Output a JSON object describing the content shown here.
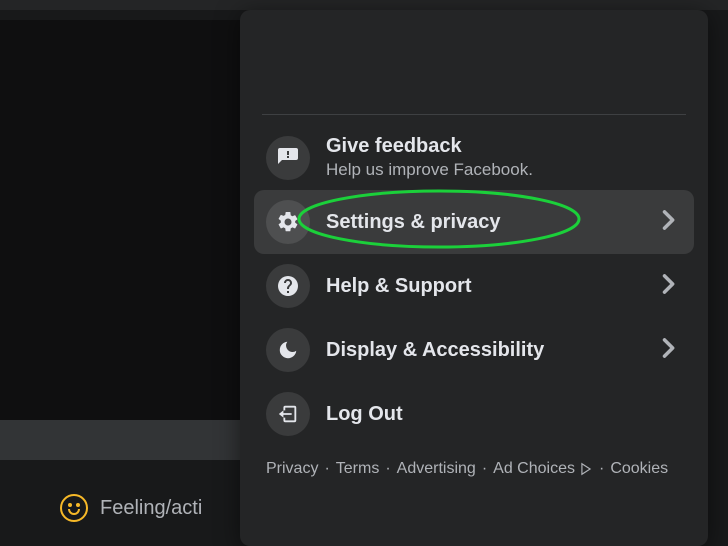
{
  "composer": {
    "feeling_label": "Feeling/acti"
  },
  "menu": {
    "feedback": {
      "title": "Give feedback",
      "subtitle": "Help us improve Facebook."
    },
    "settings": {
      "title": "Settings & privacy"
    },
    "help": {
      "title": "Help & Support"
    },
    "display": {
      "title": "Display & Accessibility"
    },
    "logout": {
      "title": "Log Out"
    }
  },
  "footer": {
    "privacy": "Privacy",
    "terms": "Terms",
    "advertising": "Advertising",
    "adchoices": "Ad Choices",
    "cookies": "Cookies"
  }
}
